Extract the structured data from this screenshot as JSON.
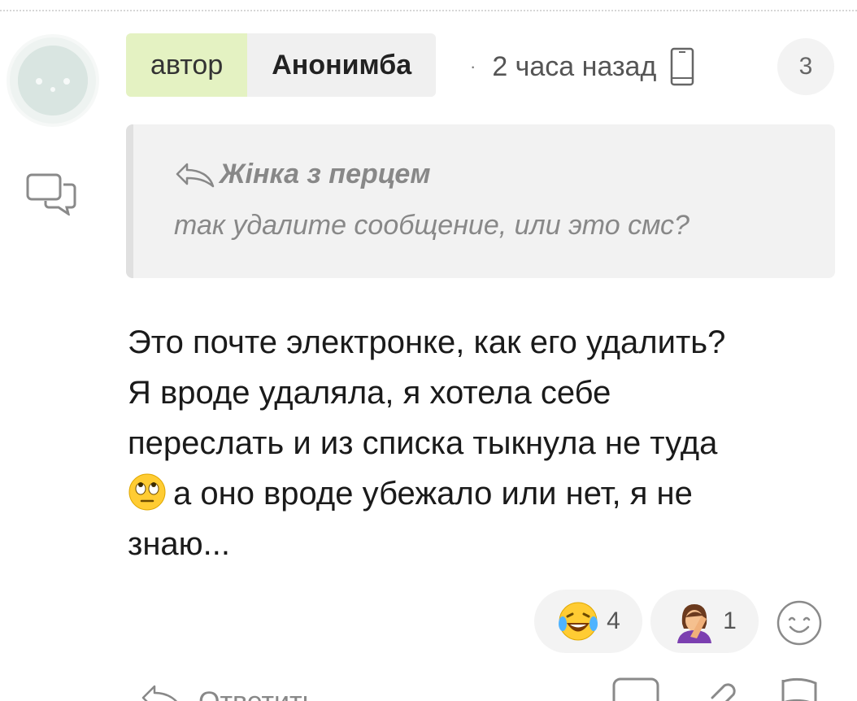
{
  "comment": {
    "author_tag": "автор",
    "author_name": "Анонимба",
    "separator": "·",
    "time": "2 часа назад",
    "reply_count": "3",
    "quote": {
      "author": "Жінка з перцем",
      "text": "так удалите сообщение, или это смс?"
    },
    "body_lines": [
      "Это почте электронке, как его удалить?",
      "Я вроде удаляла, я хотела себе",
      "переслать и из списка тыкнула не туда"
    ],
    "body_line4_after_emoji": "а оно вроде убежало или нет, я не",
    "body_line5": "знаю...",
    "reactions": [
      {
        "icon": "laughing-tears-emoji",
        "count": "4"
      },
      {
        "icon": "facepalm-emoji",
        "count": "1"
      }
    ]
  },
  "actions": {
    "reply_label": "Ответить"
  },
  "colors": {
    "author_tag_bg": "#e4f2c2",
    "pill_bg": "#f0f0f0",
    "quote_bg": "#f2f2f2",
    "muted_text": "#888888"
  },
  "icons": {
    "avatar": "ghost-avatar",
    "comment": "comment-bubble-icon",
    "device": "phone-icon",
    "reply": "reply-arrow-icon",
    "add_reaction": "smiley-add-icon"
  }
}
